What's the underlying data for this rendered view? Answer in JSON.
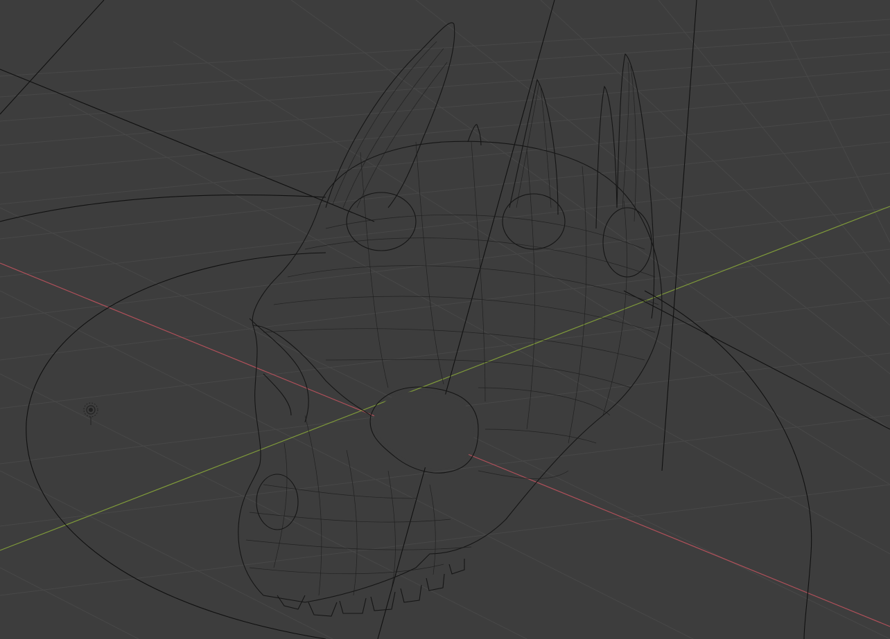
{
  "viewport": {
    "mode": "wireframe",
    "background_color": "#3d3d3d",
    "grid_color": "#484848",
    "wire_color": "#151515",
    "axis_x_color": "#b0505a",
    "axis_y_color": "#7f9a3a"
  },
  "scene_object": {
    "kind": "skull-with-horns-mesh",
    "icon": "mesh-wireframe"
  },
  "light_icon": "light-point-icon"
}
